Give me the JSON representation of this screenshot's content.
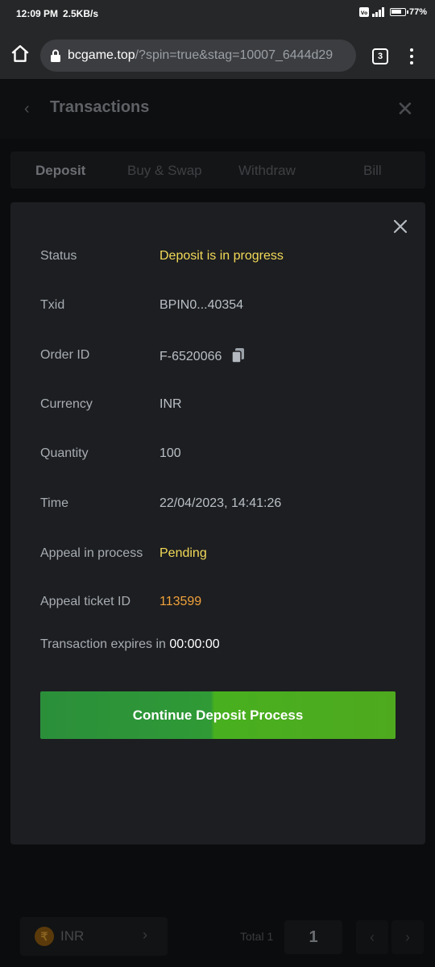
{
  "status_bar": {
    "time": "12:09 PM",
    "net_speed": "2.5KB/s",
    "battery": "77%"
  },
  "browser": {
    "url_domain": "bcgame.top",
    "url_rest": "/?spin=true&stag=10007_6444d29",
    "tab_count": "3"
  },
  "page": {
    "title": "Transactions",
    "tabs": [
      {
        "label": "Deposit",
        "active": true
      },
      {
        "label": "Buy & Swap",
        "active": false
      },
      {
        "label": "Withdraw",
        "active": false
      },
      {
        "label": "Bill",
        "active": false
      }
    ]
  },
  "modal": {
    "rows": [
      {
        "label": "Status",
        "value": "Deposit is in progress"
      },
      {
        "label": "Txid",
        "value": "BPIN0...40354"
      },
      {
        "label": "Order ID",
        "value": "F-6520066"
      },
      {
        "label": "Currency",
        "value": "INR"
      },
      {
        "label": "Quantity",
        "value": "100"
      },
      {
        "label": "Time",
        "value": "22/04/2023, 14:41:26"
      },
      {
        "label": "Appeal in process",
        "value": "Pending"
      },
      {
        "label": "Appeal ticket ID",
        "value": "113599"
      }
    ],
    "expires_label": "Transaction expires in",
    "expires_value": "00:00:00",
    "cta_label": "Continue Deposit Process"
  },
  "footer": {
    "currency": "INR",
    "currency_symbol": "₹",
    "total_label": "Total 1",
    "page_number": "1"
  },
  "colors": {
    "accent_yellow": "#f2da58",
    "accent_orange": "#f1a23b",
    "cta_green": "#2b8f3a",
    "cta_green_light": "#4ea91f",
    "modal_bg": "#1d1e21"
  }
}
